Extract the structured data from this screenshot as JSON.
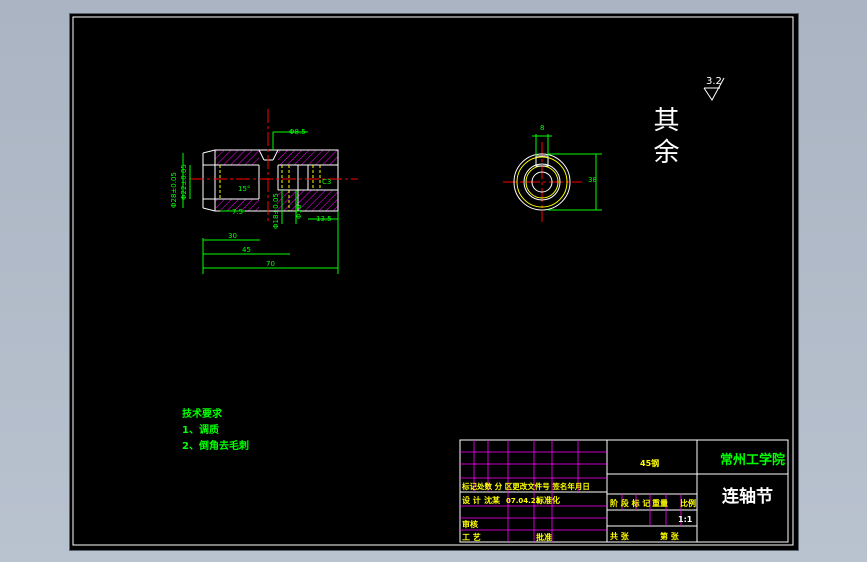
{
  "colors": {
    "background": "#000000",
    "outline": "#ffffff",
    "dimension": "#00ff00",
    "centerline": "#ff0000",
    "hatch": "#ff00ff",
    "hidden": "#ffff00",
    "titleblock_text": "#ffff00",
    "school_text": "#00ff00"
  },
  "roughness": {
    "label": "其余",
    "value": "3.2"
  },
  "front_view_dims": {
    "d_top": "Φ8.5",
    "d_left_outer": "Φ28±0.05",
    "d_left_inner": "Φ22±0.05",
    "d_bore_a": "Φ18±0.05",
    "d_bore_b": "Φ18",
    "chamfer": "C3",
    "groove": "7.5",
    "angle": "15°",
    "len_30": "30",
    "len_45": "45",
    "len_70": "70",
    "step": "13.5"
  },
  "side_view_dims": {
    "key_width": "8",
    "diameter": "38"
  },
  "tech_requirements": {
    "title": "技术要求",
    "items": [
      "1、调质",
      "2、倒角去毛刺"
    ]
  },
  "title_block": {
    "material": "45钢",
    "school": "常州工学院",
    "part_name": "连轴节",
    "row_headers": "标记处数 分 区更改文件号 签名年月日",
    "design_label": "设 计",
    "designer": "沈某",
    "date": "07.04.23",
    "standardize": "标准化",
    "review": "审核",
    "process": "工 艺",
    "approve": "批准",
    "stage_marks": "阶 段 标 记",
    "weight": "重量",
    "scale_label": "比例",
    "scale": "1:1",
    "sheets_total": "共 张",
    "sheet_no": "第 张"
  }
}
